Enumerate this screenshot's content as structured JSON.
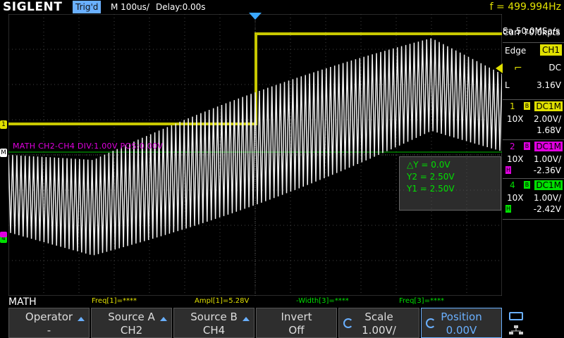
{
  "topbar": {
    "brand": "SIGLENT",
    "trigger_status": "Trig'd",
    "timebase": "M 100us/",
    "delay": "Delay:0.00s",
    "frequency": "f = 499.994Hz"
  },
  "acquisition": {
    "sample_rate": "Sa 50.0MSa/s",
    "memory": "Curr 70.0kpts"
  },
  "trigger": {
    "mode_label": "Edge",
    "source": "CH1",
    "coupling": "DC",
    "slope_label": "L",
    "level": "3.16V"
  },
  "channels": [
    {
      "num": "1",
      "coupling": "DC1M",
      "probe": "10X",
      "scale": "2.00V/",
      "offset": "1.68V",
      "color": "#e0e000"
    },
    {
      "num": "2",
      "coupling": "DC1M",
      "probe": "10X",
      "scale": "1.00V/",
      "offset": "-2.36V",
      "color": "#e000e0"
    },
    {
      "num": "4",
      "coupling": "DC1M",
      "probe": "10X",
      "scale": "1.00V/",
      "offset": "-2.42V",
      "color": "#00e000"
    }
  ],
  "math_label": "MATH  CH2-CH4  DIV:1.00V  POS:0.00V",
  "cursors": {
    "dy": "△Y = 0.0V",
    "y2": "Y2 = 2.50V",
    "y1": "Y1 = 2.50V"
  },
  "measurements": {
    "freq1": "Freq[1]=****",
    "ampl1": "Ampl[1]=5.28V",
    "width3": "-Width[3]=****",
    "freq3": "Freq[3]=****"
  },
  "menu": {
    "title": "MATH",
    "operator": {
      "label": "Operator",
      "value": "-"
    },
    "source_a": {
      "label": "Source A",
      "value": "CH2"
    },
    "source_b": {
      "label": "Source B",
      "value": "CH4"
    },
    "invert": {
      "label": "Invert",
      "value": "Off"
    },
    "scale": {
      "label": "Scale",
      "value": "1.00V/"
    },
    "position": {
      "label": "Position",
      "value": "0.00V"
    }
  },
  "markers": {
    "ch1": "1",
    "ch4": "4",
    "math": "M"
  }
}
